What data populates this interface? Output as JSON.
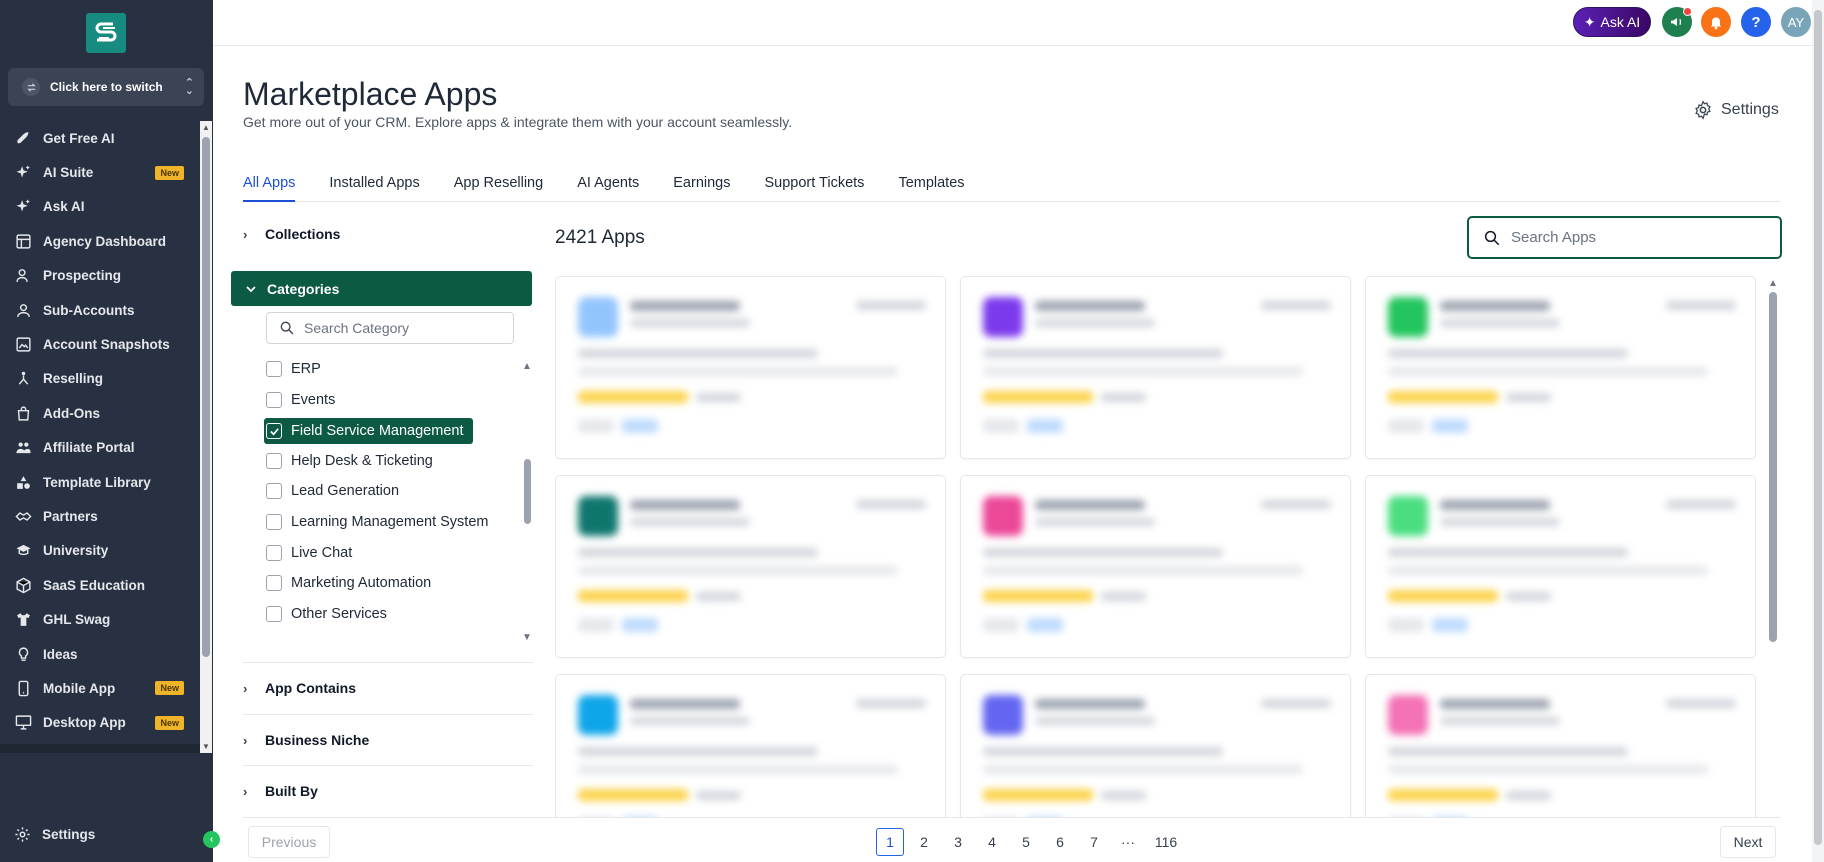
{
  "sidebar": {
    "switcher_label": "Click here to switch",
    "items": [
      {
        "label": "Get Free AI",
        "icon": "rocket-icon"
      },
      {
        "label": "AI Suite",
        "icon": "sparkle-icon",
        "badge": "New"
      },
      {
        "label": "Ask AI",
        "icon": "sparkle-icon"
      },
      {
        "label": "Agency Dashboard",
        "icon": "dashboard-icon"
      },
      {
        "label": "Prospecting",
        "icon": "person-search-icon"
      },
      {
        "label": "Sub-Accounts",
        "icon": "user-icon"
      },
      {
        "label": "Account Snapshots",
        "icon": "snapshot-icon"
      },
      {
        "label": "Reselling",
        "icon": "reselling-icon"
      },
      {
        "label": "Add-Ons",
        "icon": "bag-icon"
      },
      {
        "label": "Affiliate Portal",
        "icon": "people-icon"
      },
      {
        "label": "Template Library",
        "icon": "shapes-icon"
      },
      {
        "label": "Partners",
        "icon": "handshake-icon"
      },
      {
        "label": "University",
        "icon": "graduation-cap-icon"
      },
      {
        "label": "SaaS Education",
        "icon": "cube-icon"
      },
      {
        "label": "GHL Swag",
        "icon": "shirt-icon"
      },
      {
        "label": "Ideas",
        "icon": "lightbulb-icon"
      },
      {
        "label": "Mobile App",
        "icon": "mobile-icon",
        "badge": "New"
      },
      {
        "label": "Desktop App",
        "icon": "desktop-icon",
        "badge": "New"
      }
    ],
    "settings_label": "Settings"
  },
  "topbar": {
    "ask_ai_label": "Ask AI",
    "help_label": "?",
    "avatar_initials": "AY"
  },
  "header": {
    "title": "Marketplace Apps",
    "subtitle": "Get more out of your CRM. Explore apps & integrate them with your account seamlessly.",
    "settings_label": "Settings"
  },
  "tabs": [
    {
      "label": "All Apps",
      "active": true
    },
    {
      "label": "Installed Apps"
    },
    {
      "label": "App Reselling"
    },
    {
      "label": "AI Agents"
    },
    {
      "label": "Earnings"
    },
    {
      "label": "Support Tickets"
    },
    {
      "label": "Templates"
    }
  ],
  "filters": {
    "collections_label": "Collections",
    "categories_label": "Categories",
    "category_search_placeholder": "Search Category",
    "categories": [
      {
        "label": "ERP",
        "checked": false
      },
      {
        "label": "Events",
        "checked": false
      },
      {
        "label": "Field Service Management",
        "checked": true
      },
      {
        "label": "Help Desk & Ticketing",
        "checked": false
      },
      {
        "label": "Lead Generation",
        "checked": false
      },
      {
        "label": "Learning Management System",
        "checked": false
      },
      {
        "label": "Live Chat",
        "checked": false
      },
      {
        "label": "Marketing Automation",
        "checked": false
      },
      {
        "label": "Other Services",
        "checked": false
      }
    ],
    "app_contains_label": "App Contains",
    "business_niche_label": "Business Niche",
    "built_by_label": "Built By"
  },
  "apps": {
    "count_label": "2421 Apps",
    "search_placeholder": "Search Apps"
  },
  "pagination": {
    "prev_label": "Previous",
    "next_label": "Next",
    "pages": [
      "1",
      "2",
      "3",
      "4",
      "5",
      "6",
      "7",
      "···",
      "116"
    ],
    "current": "1"
  },
  "colors": {
    "sidebar_bg": "#283142",
    "accent_green": "#0d5a44",
    "link_blue": "#1d4ed8",
    "badge_yellow": "#f0b429"
  }
}
